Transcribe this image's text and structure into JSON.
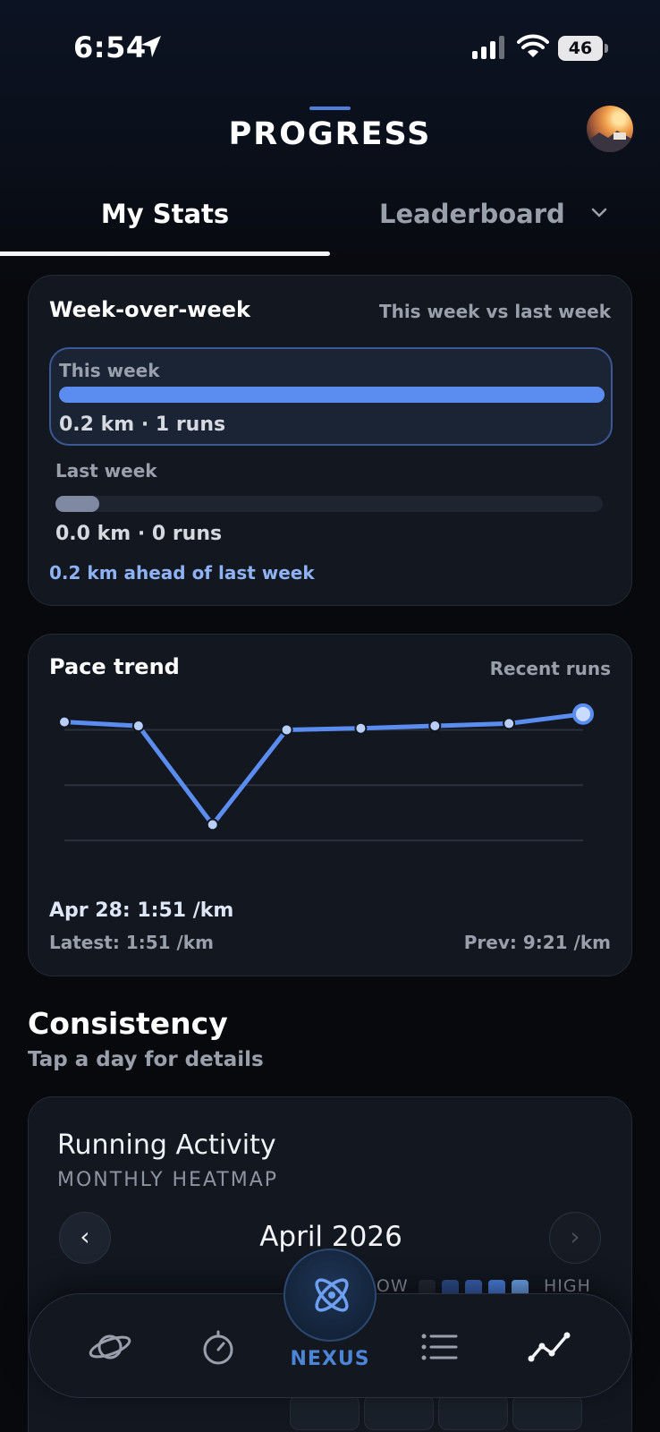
{
  "status_bar": {
    "time": "6:54",
    "battery": "46"
  },
  "header": {
    "title": "PROGRESS"
  },
  "tabs": [
    {
      "label": "My Stats",
      "active": true
    },
    {
      "label": "Leaderboard",
      "active": false
    }
  ],
  "week_over_week": {
    "title": "Week-over-week",
    "subtitle": "This week vs last week",
    "this_week": {
      "label": "This week",
      "value": "0.2 km · 1 runs",
      "fill": 1.0
    },
    "last_week": {
      "label": "Last week",
      "value": "0.0 km · 0 runs",
      "fill": 0.08
    },
    "summary": "0.2 km ahead of last week"
  },
  "pace_trend": {
    "title": "Pace trend",
    "subtitle": "Recent runs",
    "selected": "Apr 28: 1:51 /km",
    "latest": "Latest: 1:51 /km",
    "previous": "Prev: 9:21 /km"
  },
  "chart_data": {
    "type": "line",
    "title": "Pace trend",
    "series": [
      {
        "values": [
          1.0,
          0.95,
          -0.3,
          0.9,
          0.92,
          0.95,
          0.98,
          1.1
        ]
      }
    ],
    "ylim": [
      -0.5,
      1.2
    ],
    "grid": true,
    "color": "#5b8cf0"
  },
  "consistency": {
    "title": "Consistency",
    "subtitle": "Tap a day for details"
  },
  "heatmap": {
    "title": "Running Activity",
    "subtitle": "MONTHLY HEATMAP",
    "month": "April 2026",
    "prev_icon": "‹",
    "next_icon": "›",
    "legend_low": "LOW",
    "legend_high": "HIGH",
    "legend_colors": [
      "#232a36",
      "#2f4f8e",
      "#3a63b5",
      "#4a80e0",
      "#6ea6f0"
    ]
  },
  "bottom_nav": {
    "items": [
      {
        "icon": "planet-icon"
      },
      {
        "icon": "stopwatch-icon"
      },
      {
        "icon": "atom-icon",
        "label": "NEXUS"
      },
      {
        "icon": "list-icon"
      },
      {
        "icon": "trend-icon"
      }
    ],
    "center_label": "NEXUS"
  },
  "colors": {
    "accent": "#5b8cf0",
    "background": "#07090d",
    "card": "#121720"
  }
}
